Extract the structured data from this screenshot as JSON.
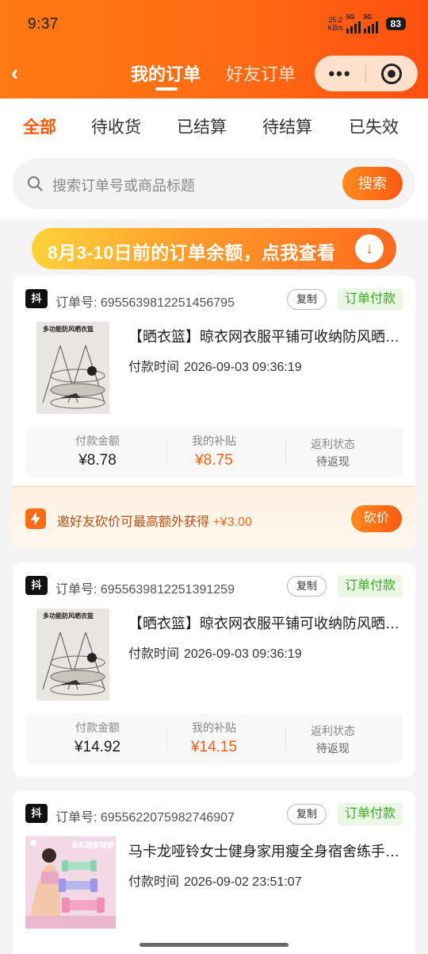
{
  "status_bar": {
    "time": "9:37",
    "speed_value": "25.2",
    "speed_unit": "KB/s",
    "net1": "5G",
    "net2": "5G",
    "battery": "83"
  },
  "header": {
    "back_glyph": "‹",
    "tabs": [
      {
        "label": "我的订单",
        "active": true
      },
      {
        "label": "好友订单",
        "active": false
      }
    ],
    "capsule_more": "•••"
  },
  "filter_tabs": [
    {
      "label": "全部",
      "active": true
    },
    {
      "label": "待收货",
      "active": false
    },
    {
      "label": "已结算",
      "active": false
    },
    {
      "label": "待结算",
      "active": false
    },
    {
      "label": "已失效",
      "active": false
    }
  ],
  "search": {
    "placeholder": "搜索订单号或商品标题",
    "button": "搜索"
  },
  "banner": {
    "text": "8月3-10日前的订单余额，点我查看"
  },
  "orders": [
    {
      "platform_badge": "抖",
      "order_no": "订单号: 6955639812251456795",
      "copy_label": "复制",
      "status": "订单付款",
      "thumb_caption": "多功能防风晒衣篮",
      "title": "【晒衣篮】晾衣网衣服平铺可收纳防风晒衣架多层衣物晾晒网",
      "time_label": "付款时间",
      "time_value": "2026-09-03 09:36:19",
      "pay_label": "付款金额",
      "pay_value": "¥8.78",
      "subsidy_label": "我的补贴",
      "subsidy_value": "¥8.75",
      "rebate_label": "返利状态",
      "rebate_value": "待返现",
      "promo_text": "邀好友砍价可最高额外获得 ",
      "promo_amount": "+¥3.00",
      "promo_button": "砍价"
    },
    {
      "platform_badge": "抖",
      "order_no": "订单号: 6955639812251391259",
      "copy_label": "复制",
      "status": "订单付款",
      "thumb_caption": "多功能防风晒衣篮",
      "title": "【晒衣篮】晾衣网衣服平铺可收纳防风晒衣架多层衣物晾晒网",
      "time_label": "付款时间",
      "time_value": "2026-09-03 09:36:19",
      "pay_label": "付款金额",
      "pay_value": "¥14.92",
      "subsidy_label": "我的补贴",
      "subsidy_value": "¥14.15",
      "rebate_label": "返利状态",
      "rebate_value": "待返现"
    },
    {
      "platform_badge": "抖",
      "order_no": "订单号: 6955622075982746907",
      "copy_label": "复制",
      "status": "订单付款",
      "thumb_caption": "多彩居家哑铃",
      "title": "马卡龙哑铃女士健身家用瘦全身宿舍练手臂小哑铃",
      "time_label": "付款时间",
      "time_value": "2026-09-02 23:51:07"
    }
  ],
  "colors": {
    "brand_orange": "#ff6a14",
    "status_green": "#3eaa26"
  }
}
